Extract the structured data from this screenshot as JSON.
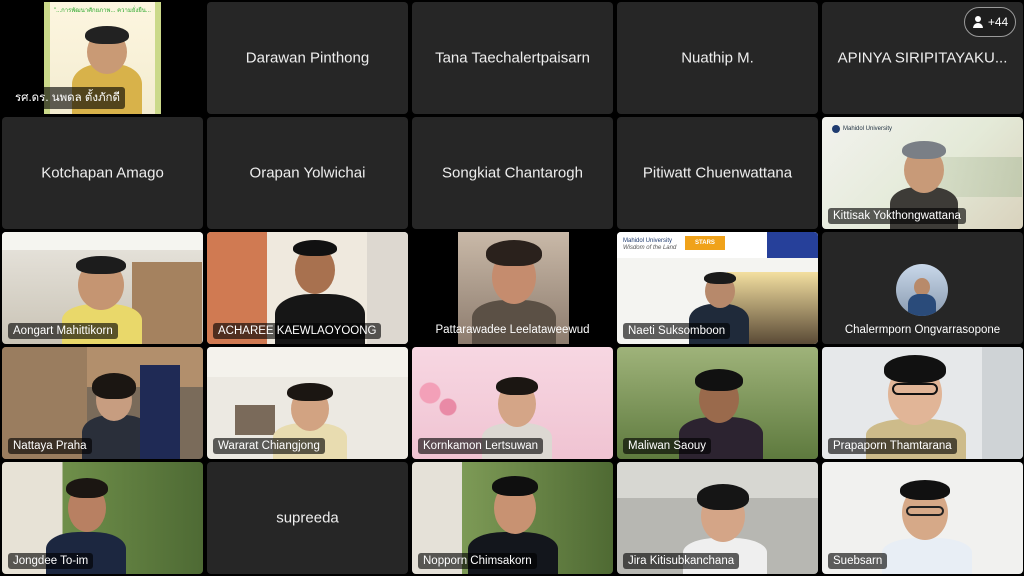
{
  "overflow": {
    "label": "+44",
    "icon": "people-icon"
  },
  "tiles": [
    {
      "name": "รศ.ดร. นพดล ตั้งภักดี",
      "banner": "\"...การพัฒนาศักยภาพ... ความยั่งยืน...\""
    },
    {
      "name": "Darawan Pinthong"
    },
    {
      "name": "Tana Taechalertpaisarn"
    },
    {
      "name": "Nuathip M."
    },
    {
      "name": "APINYA SIRIPITAYAKU..."
    },
    {
      "name": "Kotchapan Amago"
    },
    {
      "name": "Orapan Yolwichai"
    },
    {
      "name": "Songkiat Chantarogh"
    },
    {
      "name": "Pitiwatt Chuenwattana"
    },
    {
      "name": "Kittisak Yokthongwattana",
      "logo": "Mahidol University"
    },
    {
      "name": "Aongart Mahittikorn"
    },
    {
      "name": "ACHAREE KAEWLAOYOONG"
    },
    {
      "name": "Pattarawadee Leelataweewud"
    },
    {
      "name": "Naeti Suksomboon",
      "logo": "Mahidol University",
      "logo_sub": "Wisdom of the Land",
      "badge": "STARS"
    },
    {
      "name": "Chalermporn Ongvarrasopone"
    },
    {
      "name": "Nattaya Praha"
    },
    {
      "name": "Wararat Chiangjong"
    },
    {
      "name": "Kornkamon Lertsuwan"
    },
    {
      "name": "Maliwan Saouy"
    },
    {
      "name": "Prapaporn Thamtarana"
    },
    {
      "name": "Jongdee To-im"
    },
    {
      "name": "supreeda"
    },
    {
      "name": "Nopporn Chimsakorn"
    },
    {
      "name": "Jira Kitisubkanchana"
    },
    {
      "name": "Suebsarn"
    }
  ]
}
